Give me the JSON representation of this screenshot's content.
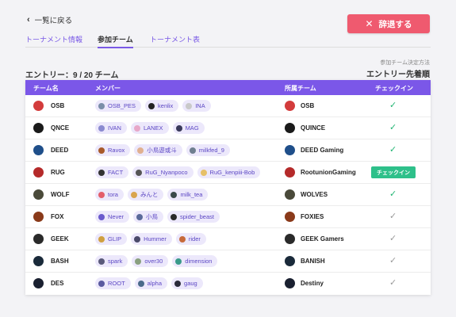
{
  "nav": {
    "back_label": "一覧に戻る"
  },
  "withdraw_button": {
    "label": "辞退する",
    "color": "#ef5a6f"
  },
  "tabs": [
    {
      "label": "トーナメント情報",
      "active": false
    },
    {
      "label": "参加チーム",
      "active": true
    },
    {
      "label": "トーナメント表",
      "active": false
    }
  ],
  "entry_summary": "エントリー：9 / 20 チーム",
  "method": {
    "caption": "参加チーム決定方法",
    "value": "エントリー先着順"
  },
  "table": {
    "header_color": "#7b57e8",
    "columns": {
      "team": "チーム名",
      "members": "メンバー",
      "affiliation": "所属チーム",
      "checkin": "チェックイン"
    },
    "rows": [
      {
        "team": "OSB",
        "logo_color": "#d33c3c",
        "members": [
          {
            "name": "OSB_PES",
            "avatar_color": "#7a8ea8"
          },
          {
            "name": "kenlix",
            "avatar_color": "#222222"
          },
          {
            "name": "INA",
            "avatar_color": "#c9c9c9"
          }
        ],
        "affiliation": "OSB",
        "checkin": "done"
      },
      {
        "team": "QNCE",
        "logo_color": "#1a1a1a",
        "members": [
          {
            "name": "IVAN",
            "avatar_color": "#8a8ad0"
          },
          {
            "name": "LANEX",
            "avatar_color": "#e7a7c8"
          },
          {
            "name": "MAG",
            "avatar_color": "#3a3a5a"
          }
        ],
        "affiliation": "QUINCE",
        "checkin": "done"
      },
      {
        "team": "DEED",
        "logo_color": "#1f4f8a",
        "members": [
          {
            "name": "Ravox",
            "avatar_color": "#a85a2a"
          },
          {
            "name": "小鳥遊或斗",
            "avatar_color": "#e0b090"
          },
          {
            "name": "milkfed_9",
            "avatar_color": "#6f7f90"
          }
        ],
        "affiliation": "DEED Gaming",
        "checkin": "done"
      },
      {
        "team": "RUG",
        "logo_color": "#b52a2a",
        "members": [
          {
            "name": "FACT",
            "avatar_color": "#333333"
          },
          {
            "name": "RuG_Nyanpoco",
            "avatar_color": "#555555"
          },
          {
            "name": "RuG_kenpiii-Bob",
            "avatar_color": "#e6c069"
          }
        ],
        "affiliation": "RootunionGaming",
        "checkin": "button",
        "checkin_label": "チェックイン"
      },
      {
        "team": "WOLF",
        "logo_color": "#4a4a3a",
        "members": [
          {
            "name": "tora",
            "avatar_color": "#e35d6a"
          },
          {
            "name": "みんと",
            "avatar_color": "#d9a44e"
          },
          {
            "name": "milk_tea",
            "avatar_color": "#3a4a4a"
          }
        ],
        "affiliation": "WOLVES",
        "checkin": "done"
      },
      {
        "team": "FOX",
        "logo_color": "#8a3a1a",
        "members": [
          {
            "name": "Never",
            "avatar_color": "#6a5acd"
          },
          {
            "name": "小鳥",
            "avatar_color": "#5a6a9a"
          },
          {
            "name": "spider_beast",
            "avatar_color": "#2a2a2a"
          }
        ],
        "affiliation": "FOXIES",
        "checkin": "pending"
      },
      {
        "team": "GEEK",
        "logo_color": "#2a2a2a",
        "members": [
          {
            "name": "GLIP",
            "avatar_color": "#d0a040"
          },
          {
            "name": "Hummer",
            "avatar_color": "#4a4a6a"
          },
          {
            "name": "rider",
            "avatar_color": "#c76a3a"
          }
        ],
        "affiliation": "GEEK Gamers",
        "checkin": "pending"
      },
      {
        "team": "BASH",
        "logo_color": "#1a2a3a",
        "members": [
          {
            "name": "spark",
            "avatar_color": "#5a5a7a"
          },
          {
            "name": "over30",
            "avatar_color": "#8aa080"
          },
          {
            "name": "dimension",
            "avatar_color": "#3a9a8a"
          }
        ],
        "affiliation": "BANISH",
        "checkin": "pending"
      },
      {
        "team": "DES",
        "logo_color": "#1a2030",
        "members": [
          {
            "name": "ROOT",
            "avatar_color": "#5a5aa0"
          },
          {
            "name": "alpha",
            "avatar_color": "#4a6a8a"
          },
          {
            "name": "gaug",
            "avatar_color": "#2a2a3a"
          }
        ],
        "affiliation": "Destiny",
        "checkin": "pending"
      }
    ]
  }
}
